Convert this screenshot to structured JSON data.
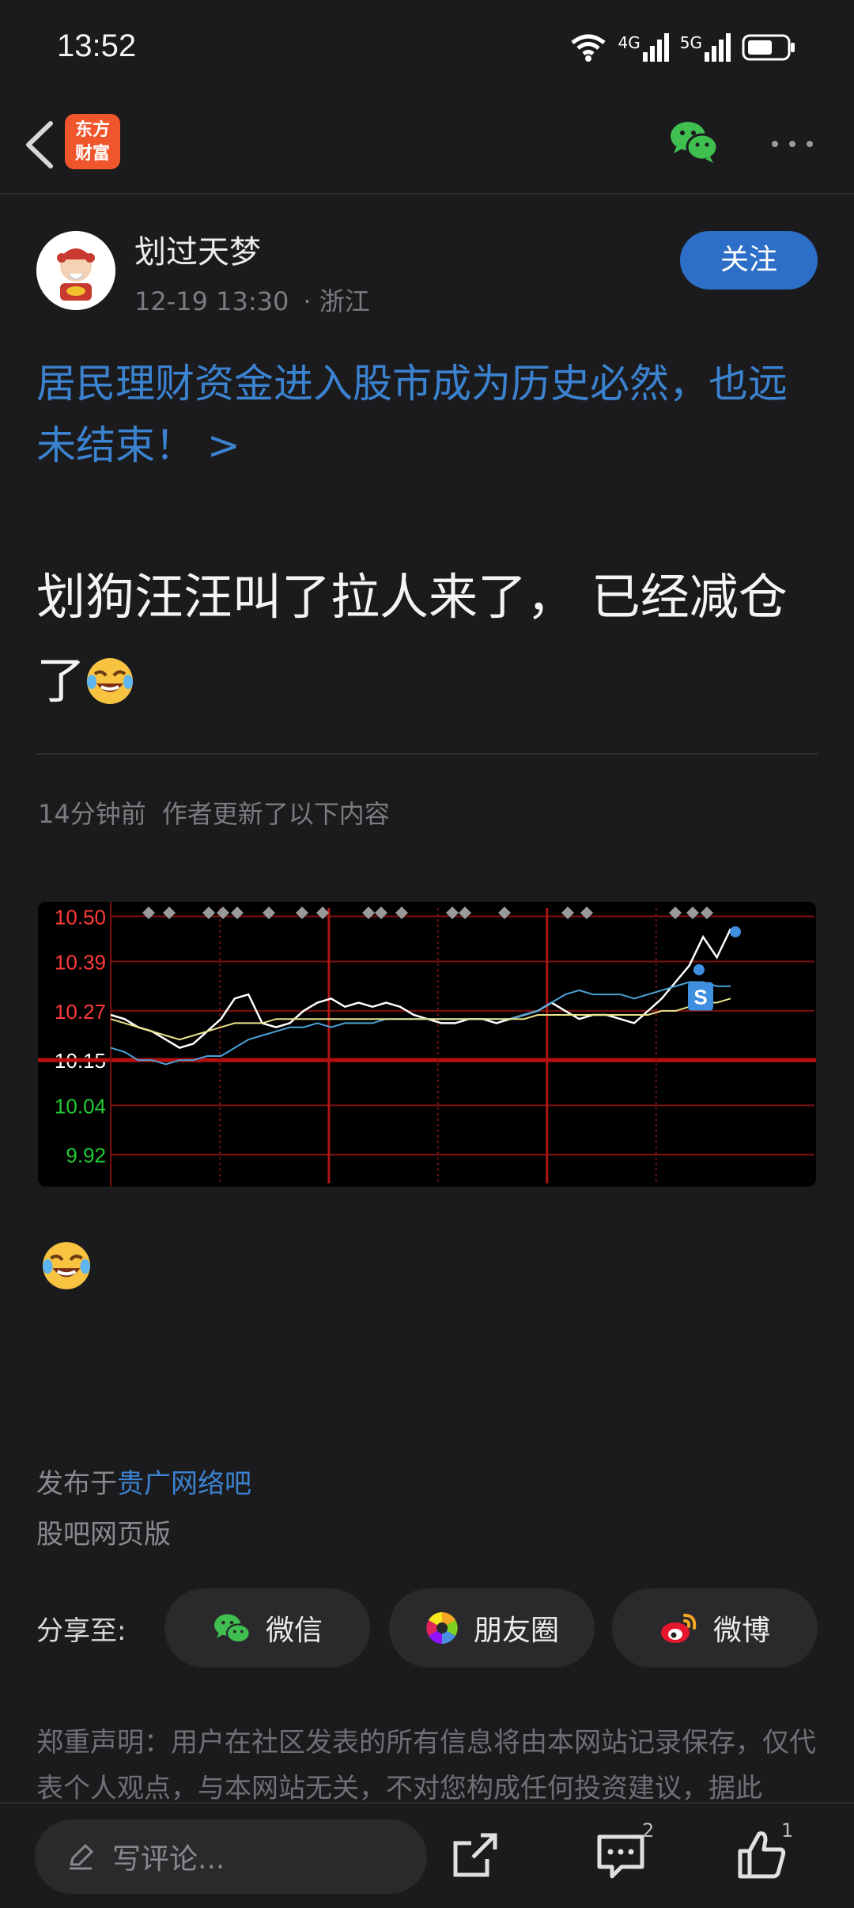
{
  "status_bar": {
    "time": "13:52",
    "signal_1": "4G",
    "signal_2": "5G"
  },
  "nav": {
    "logo_line1": "东方",
    "logo_line2": "财富"
  },
  "post": {
    "author": "划过天梦",
    "date": "12-19 13:30",
    "location": "· 浙江",
    "follow_label": "关注",
    "topic": "居民理财资金进入股市成为历史必然，也远未结束！ >",
    "body": "划狗汪汪叫了拉人来了， 已经减仓了",
    "update_time": "14分钟前",
    "update_text": "作者更新了以下内容"
  },
  "chart_data": {
    "type": "line",
    "y_tick_labels": [
      "10.50",
      "10.39",
      "10.27",
      "10.15",
      "10.04",
      "9.92"
    ],
    "ylim": [
      9.85,
      10.52
    ],
    "red_ticks": [
      "10.50",
      "10.39",
      "10.27"
    ],
    "green_ticks": [
      "10.04",
      "9.92"
    ],
    "reference_price": 10.15,
    "marker_label": "S",
    "series": [
      {
        "color": "#ffffff",
        "values": [
          10.26,
          10.25,
          10.23,
          10.22,
          10.2,
          10.18,
          10.19,
          10.22,
          10.25,
          10.3,
          10.31,
          10.24,
          10.23,
          10.24,
          10.27,
          10.29,
          10.3,
          10.28,
          10.29,
          10.28,
          10.29,
          10.28,
          10.26,
          10.25,
          10.24,
          10.24,
          10.25,
          10.25,
          10.24,
          10.25,
          10.26,
          10.27,
          10.29,
          10.27,
          10.25,
          10.26,
          10.26,
          10.25,
          10.24,
          10.27,
          10.3,
          10.34,
          10.38,
          10.45,
          10.4,
          10.47
        ]
      },
      {
        "color": "#4aa3d8",
        "values": [
          10.18,
          10.17,
          10.15,
          10.15,
          10.14,
          10.15,
          10.15,
          10.16,
          10.16,
          10.18,
          10.2,
          10.21,
          10.22,
          10.23,
          10.23,
          10.24,
          10.23,
          10.24,
          10.24,
          10.24,
          10.25,
          10.25,
          10.25,
          10.25,
          10.25,
          10.25,
          10.25,
          10.25,
          10.25,
          10.25,
          10.26,
          10.27,
          10.29,
          10.31,
          10.32,
          10.31,
          10.31,
          10.31,
          10.3,
          10.31,
          10.32,
          10.33,
          10.34,
          10.34,
          10.33,
          10.33
        ]
      },
      {
        "color": "#e8e48a",
        "values": [
          10.25,
          10.24,
          10.23,
          10.22,
          10.21,
          10.2,
          10.21,
          10.22,
          10.23,
          10.24,
          10.24,
          10.24,
          10.25,
          10.25,
          10.25,
          10.25,
          10.25,
          10.25,
          10.25,
          10.25,
          10.25,
          10.25,
          10.25,
          10.25,
          10.25,
          10.25,
          10.25,
          10.25,
          10.25,
          10.25,
          10.25,
          10.26,
          10.26,
          10.26,
          10.26,
          10.26,
          10.26,
          10.26,
          10.26,
          10.26,
          10.27,
          10.27,
          10.28,
          10.29,
          10.29,
          10.3
        ]
      }
    ]
  },
  "footer": {
    "published_prefix": "发布于",
    "published_bar": "贵广网络吧",
    "web_version": "股吧网页版",
    "share_label": "分享至:",
    "share_wechat": "微信",
    "share_moments": "朋友圈",
    "share_weibo": "微博",
    "disclaimer": "郑重声明：用户在社区发表的所有信息将由本网站记录保存，仅代表个人观点，与本网站无关，不对您构成任何投资建议，据此"
  },
  "bottom_bar": {
    "comment_placeholder": "写评论...",
    "comment_count": "2",
    "like_count": "1"
  }
}
